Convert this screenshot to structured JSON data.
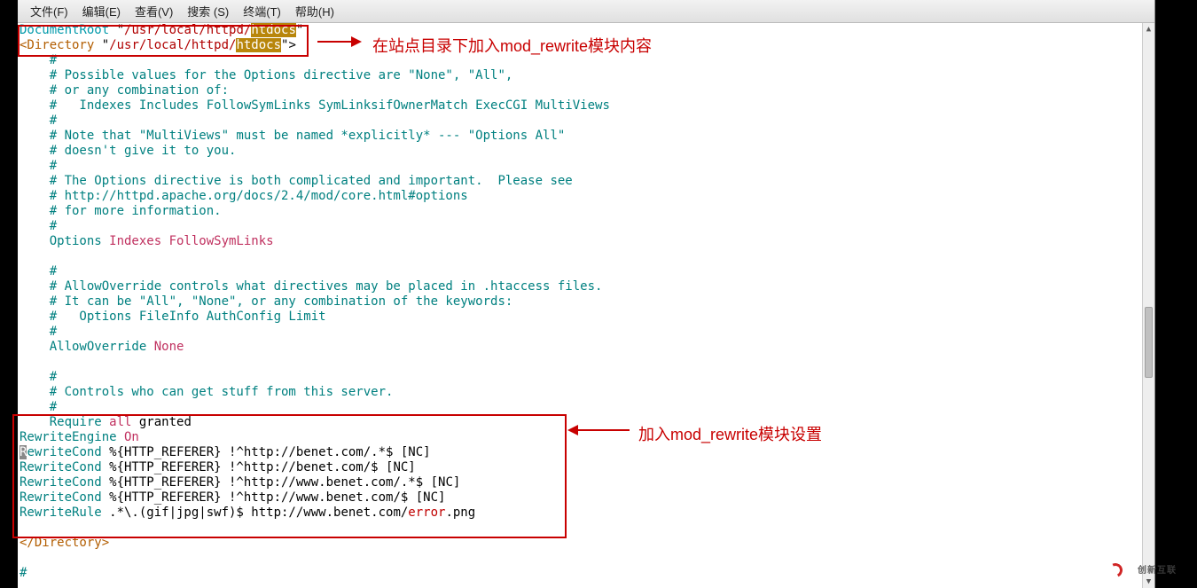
{
  "menu": {
    "file": "文件(F)",
    "edit": "编辑(E)",
    "view": "查看(V)",
    "search": "搜索 (S)",
    "terminal": "终端(T)",
    "help": "帮助(H)"
  },
  "editor": {
    "line1_a": "DocumentRoot",
    "line1_b": " \"",
    "line1_c": "/usr/local/httpd/",
    "line1_d": "htdocs",
    "line1_e": "\"",
    "line2_a": "<Directory",
    "line2_b": " \"",
    "line2_c": "/usr/local/httpd/",
    "line2_d": "htdocs",
    "line2_e": "\">",
    "l3": "    #",
    "l4": "    # Possible values for the Options directive are \"None\", \"All\",",
    "l5": "    # or any combination of:",
    "l6": "    #   Indexes Includes FollowSymLinks SymLinksifOwnerMatch ExecCGI MultiViews",
    "l7": "    #",
    "l8": "    # Note that \"MultiViews\" must be named *explicitly* --- \"Options All\"",
    "l9": "    # doesn't give it to you.",
    "l10": "    #",
    "l11": "    # The Options directive is both complicated and important.  Please see",
    "l12": "    # http://httpd.apache.org/docs/2.4/mod/core.html#options",
    "l13": "    # for more information.",
    "l14": "    #",
    "l15a": "    Options",
    "l15b": " Indexes FollowSymLinks",
    "l16": "",
    "l17": "    #",
    "l18": "    # AllowOverride controls what directives may be placed in .htaccess files.",
    "l19": "    # It can be \"All\", \"None\", or any combination of the keywords:",
    "l20": "    #   Options FileInfo AuthConfig Limit",
    "l21": "    #",
    "l22a": "    AllowOverride",
    "l22b": " None",
    "l23": "",
    "l24": "    #",
    "l25": "    # Controls who can get stuff from this server.",
    "l26": "    #",
    "l27a": "    Require ",
    "l27b": "all",
    "l27c": " granted",
    "l28a": "RewriteEngine",
    "l28b": " On",
    "l29_cursor": "R",
    "l29a": "ewriteCond",
    "l29b": " %{HTTP_REFERER} !^http://benet.com/.*$ [NC]",
    "l30a": "RewriteCond",
    "l30b": " %{HTTP_REFERER} !^http://benet.com/$ [NC]",
    "l31a": "RewriteCond",
    "l31b": " %{HTTP_REFERER} !^http://www.benet.com/.*$ [NC]",
    "l32a": "RewriteCond",
    "l32b": " %{HTTP_REFERER} !^http://www.benet.com/$ [NC]",
    "l33a": "RewriteRule",
    "l33b": " .*\\.(gif|jpg|swf)$ http://www.benet.com/",
    "l33c": "error",
    "l33d": ".png",
    "l34": "",
    "l35": "</Directory>",
    "l36": "",
    "l37": "#"
  },
  "annotations": {
    "top": "在站点目录下加入mod_rewrite模块内容",
    "bottom": "加入mod_rewrite模块设置"
  },
  "watermark": "创新互联"
}
